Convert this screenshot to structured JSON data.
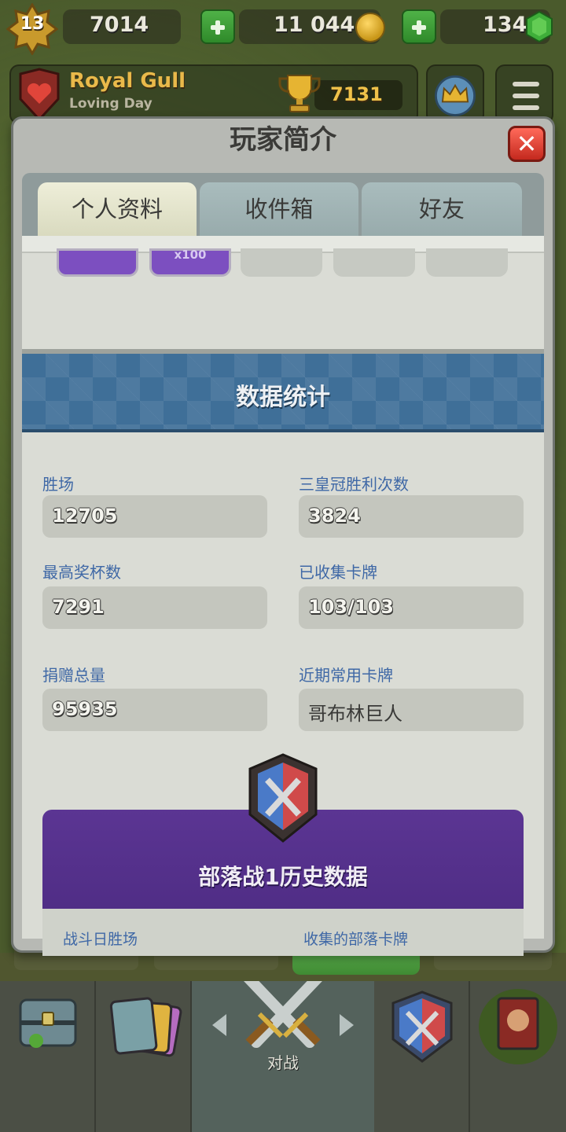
{
  "top_bar": {
    "level": "13",
    "exp": "7014",
    "gold": "11 044",
    "gems": "134"
  },
  "player": {
    "name": "Royal Gull",
    "clan": "Loving Day",
    "trophies": "7131"
  },
  "modal": {
    "title": "玩家简介",
    "close_symbol": "✕",
    "tabs": [
      {
        "label": "个人资料",
        "active": true
      },
      {
        "label": "收件箱",
        "active": false
      },
      {
        "label": "好友",
        "active": false
      }
    ],
    "cards_strip": {
      "x100_label": "x100"
    }
  },
  "stats": {
    "section_title": "数据统计",
    "items": [
      {
        "label": "胜场",
        "value": "12705"
      },
      {
        "label": "三皇冠胜利次数",
        "value": "3824"
      },
      {
        "label": "最高奖杯数",
        "value": "7291"
      },
      {
        "label": "已收集卡牌",
        "value": "103/103"
      },
      {
        "label": "捐赠总量",
        "value": "95935"
      },
      {
        "label": "近期常用卡牌",
        "value": "哥布林巨人"
      }
    ]
  },
  "clan_war": {
    "title": "部落战1历史数据",
    "sub_left": "战斗日胜场",
    "sub_right": "收集的部落卡牌"
  },
  "bottom_nav": {
    "active_label": "对战"
  },
  "colors": {
    "stat_label": "#3f68a6",
    "banner_blue": "#3f6f98",
    "clan_purple": "#5b3593",
    "close_red": "#d8372a"
  }
}
